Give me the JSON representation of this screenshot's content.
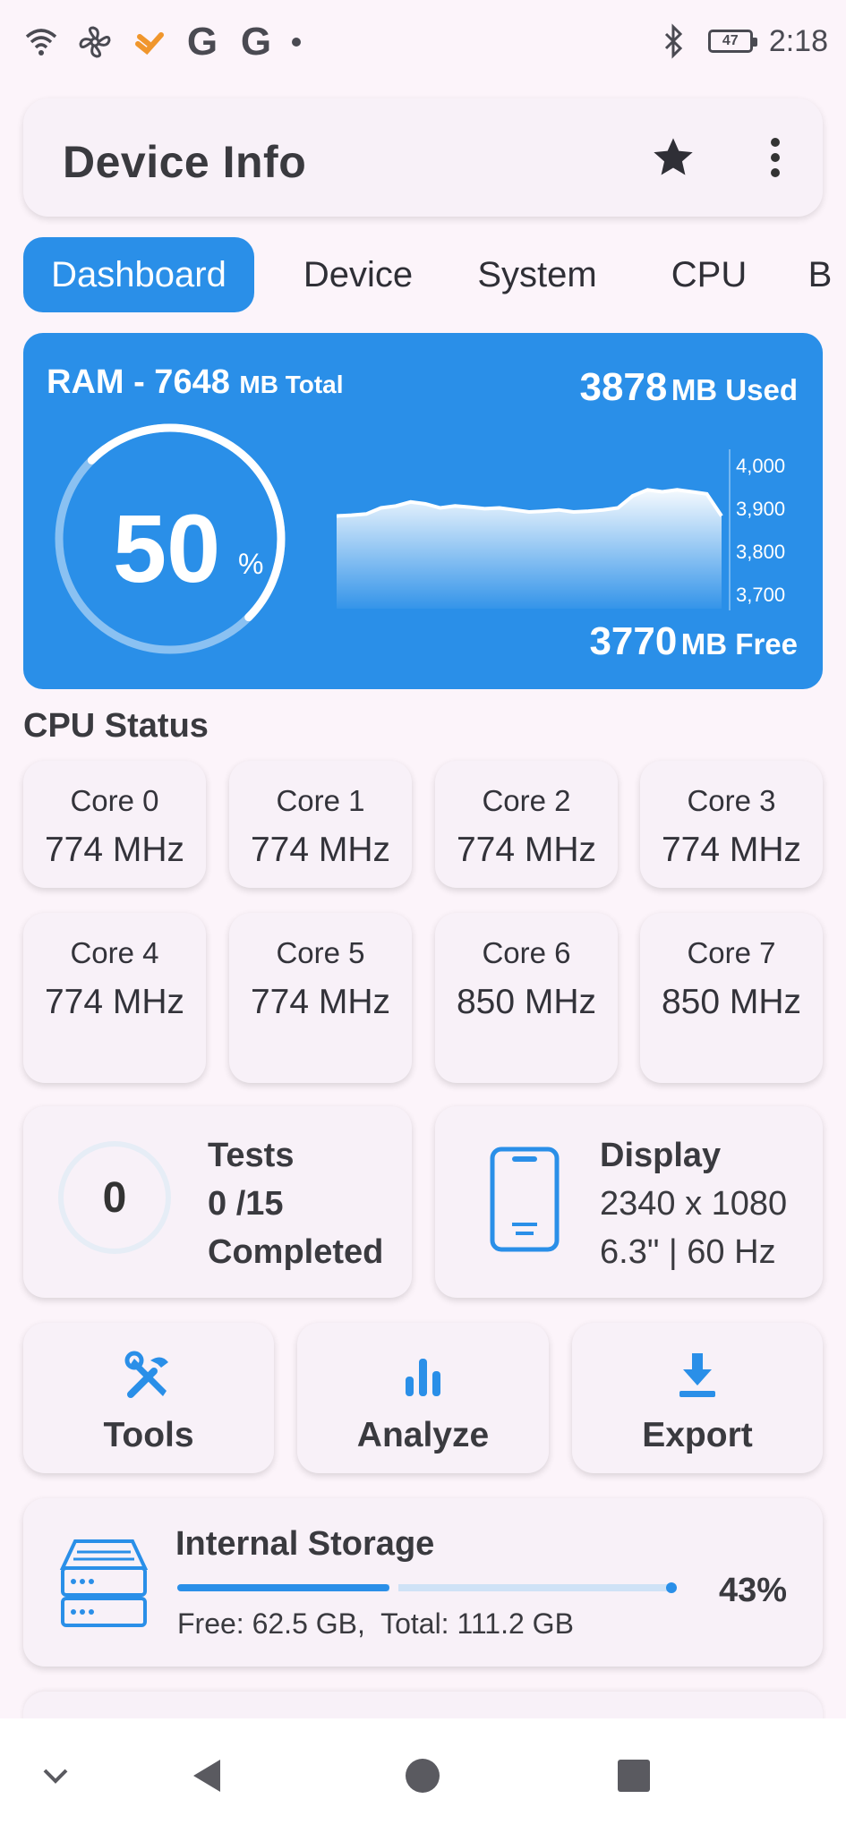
{
  "status_bar": {
    "icons": [
      "wifi-icon",
      "fan-icon",
      "app-notification-icon",
      "google-icon",
      "google-icon",
      "more-notifications-dot"
    ],
    "google_letter": "G",
    "bluetooth": "bluetooth-icon",
    "battery_level": "47",
    "time": "2:18"
  },
  "appbar": {
    "title": "Device Info",
    "favorite_icon": "star-icon",
    "menu_icon": "more-vert-icon"
  },
  "tabs": [
    {
      "label": "Dashboard",
      "active": true
    },
    {
      "label": "Device",
      "active": false
    },
    {
      "label": "System",
      "active": false
    },
    {
      "label": "CPU",
      "active": false
    },
    {
      "label": "B",
      "active": false
    }
  ],
  "ram": {
    "title_prefix": "RAM - 7648",
    "title_suffix": "MB Total",
    "used_value": "3878",
    "used_unit": "MB Used",
    "free_value": "3770",
    "free_unit": "MB Free",
    "percent_value": "50",
    "percent_sign": "%",
    "percent_fraction": 0.5,
    "y_ticks": [
      "4,000",
      "3,900",
      "3,800",
      "3,700"
    ]
  },
  "chart_data": {
    "type": "area",
    "title": "",
    "xlabel": "",
    "ylabel": "",
    "ylim": [
      3650,
      4050
    ],
    "y_ticks": [
      4000,
      3900,
      3800,
      3700
    ],
    "series": [
      {
        "values": [
          3880,
          3882,
          3885,
          3900,
          3905,
          3915,
          3910,
          3900,
          3905,
          3902,
          3898,
          3900,
          3895,
          3890,
          3892,
          3895,
          3890,
          3892,
          3895,
          3900,
          3930,
          3945,
          3940,
          3945,
          3940,
          3935,
          3880
        ]
      }
    ],
    "grid": false,
    "legend": "none"
  },
  "cpu": {
    "heading": "CPU Status",
    "cores": [
      {
        "name": "Core 0",
        "freq": "774 MHz"
      },
      {
        "name": "Core 1",
        "freq": "774 MHz"
      },
      {
        "name": "Core 2",
        "freq": "774 MHz"
      },
      {
        "name": "Core 3",
        "freq": "774 MHz"
      },
      {
        "name": "Core 4",
        "freq": "774 MHz"
      },
      {
        "name": "Core 5",
        "freq": "774 MHz"
      },
      {
        "name": "Core 6",
        "freq": "850 MHz"
      },
      {
        "name": "Core 7",
        "freq": "850 MHz"
      }
    ]
  },
  "tests": {
    "value": "0",
    "title": "Tests",
    "count": "0 /15",
    "status": "Completed"
  },
  "display": {
    "icon": "smartphone-icon",
    "title": "Display",
    "resolution": "2340 x 1080",
    "spec": "6.3\" | 60 Hz"
  },
  "actions": [
    {
      "label": "Tools",
      "icon": "tools-icon"
    },
    {
      "label": "Analyze",
      "icon": "bar-chart-icon"
    },
    {
      "label": "Export",
      "icon": "download-icon"
    }
  ],
  "storage": {
    "icon": "storage-drive-icon",
    "title": "Internal Storage",
    "percent": "43%",
    "used_fraction": 0.43,
    "detail": "Free: 62.5 GB,  Total: 111.2 GB"
  },
  "colors": {
    "accent": "#2a8fe8",
    "background": "#fcf4fa",
    "card": "#f8f1f8"
  },
  "navbar": {
    "buttons": [
      "chevron-down-icon",
      "back-icon",
      "home-icon",
      "recents-icon"
    ]
  }
}
